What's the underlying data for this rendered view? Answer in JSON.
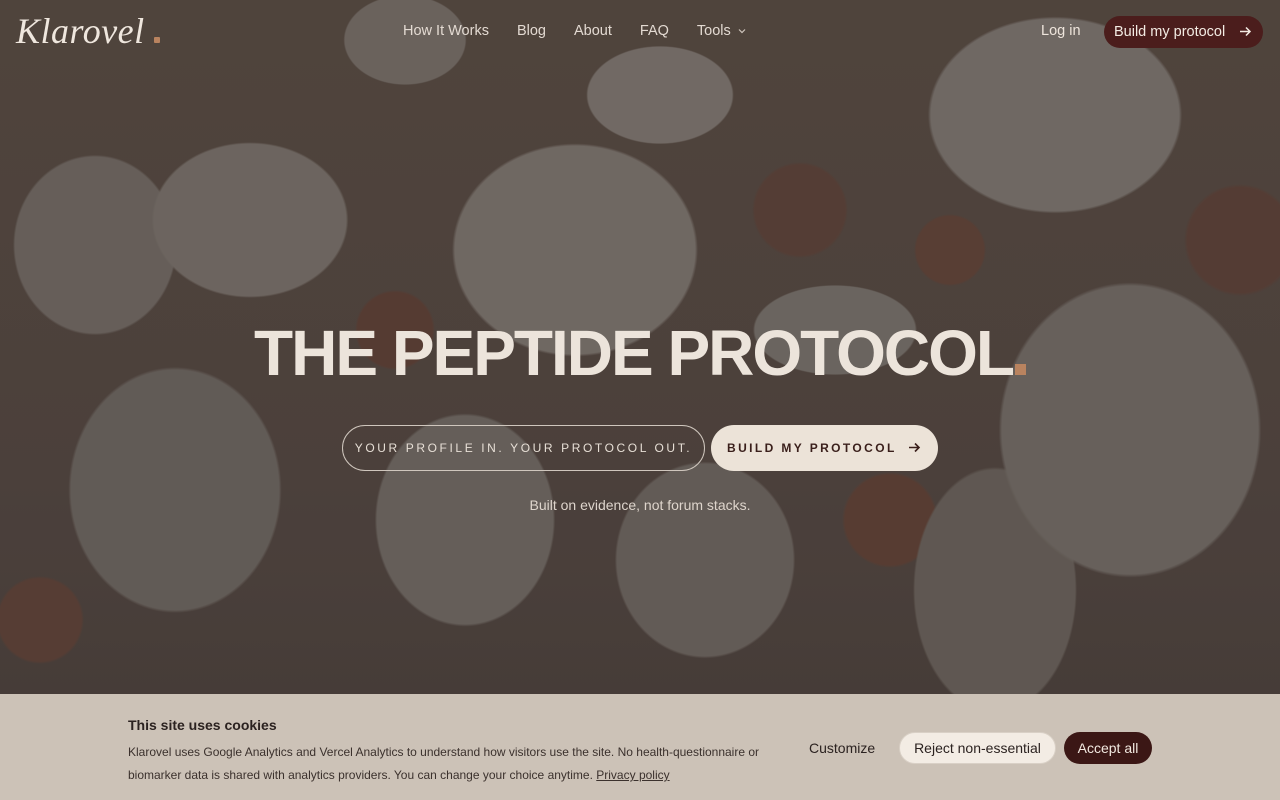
{
  "brand": {
    "name": "Klarovel",
    "accent_color": "#b9835f"
  },
  "nav": {
    "items": [
      {
        "label": "How It Works"
      },
      {
        "label": "Blog"
      },
      {
        "label": "About"
      },
      {
        "label": "FAQ"
      },
      {
        "label": "Tools",
        "icon": "chevron-down-icon"
      }
    ],
    "login_label": "Log in",
    "cta_label": "Build my protocol",
    "cta_color": "#4b1d1c"
  },
  "hero": {
    "title": "THE PEPTIDE PROTOCOL",
    "tagline_pill": "YOUR PROFILE IN. YOUR PROTOCOL OUT.",
    "cta_label": "BUILD MY PROTOCOL",
    "subline": "Built on evidence, not forum stacks."
  },
  "cookie_banner": {
    "title": "This site uses cookies",
    "body": "Klarovel uses Google Analytics and Vercel Analytics to understand how visitors use the site. No health-questionnaire or biomarker data is shared with analytics providers. You can change your choice anytime.",
    "privacy_link": "Privacy policy",
    "customize_label": "Customize",
    "reject_label": "Reject non-essential",
    "accept_label": "Accept all"
  }
}
